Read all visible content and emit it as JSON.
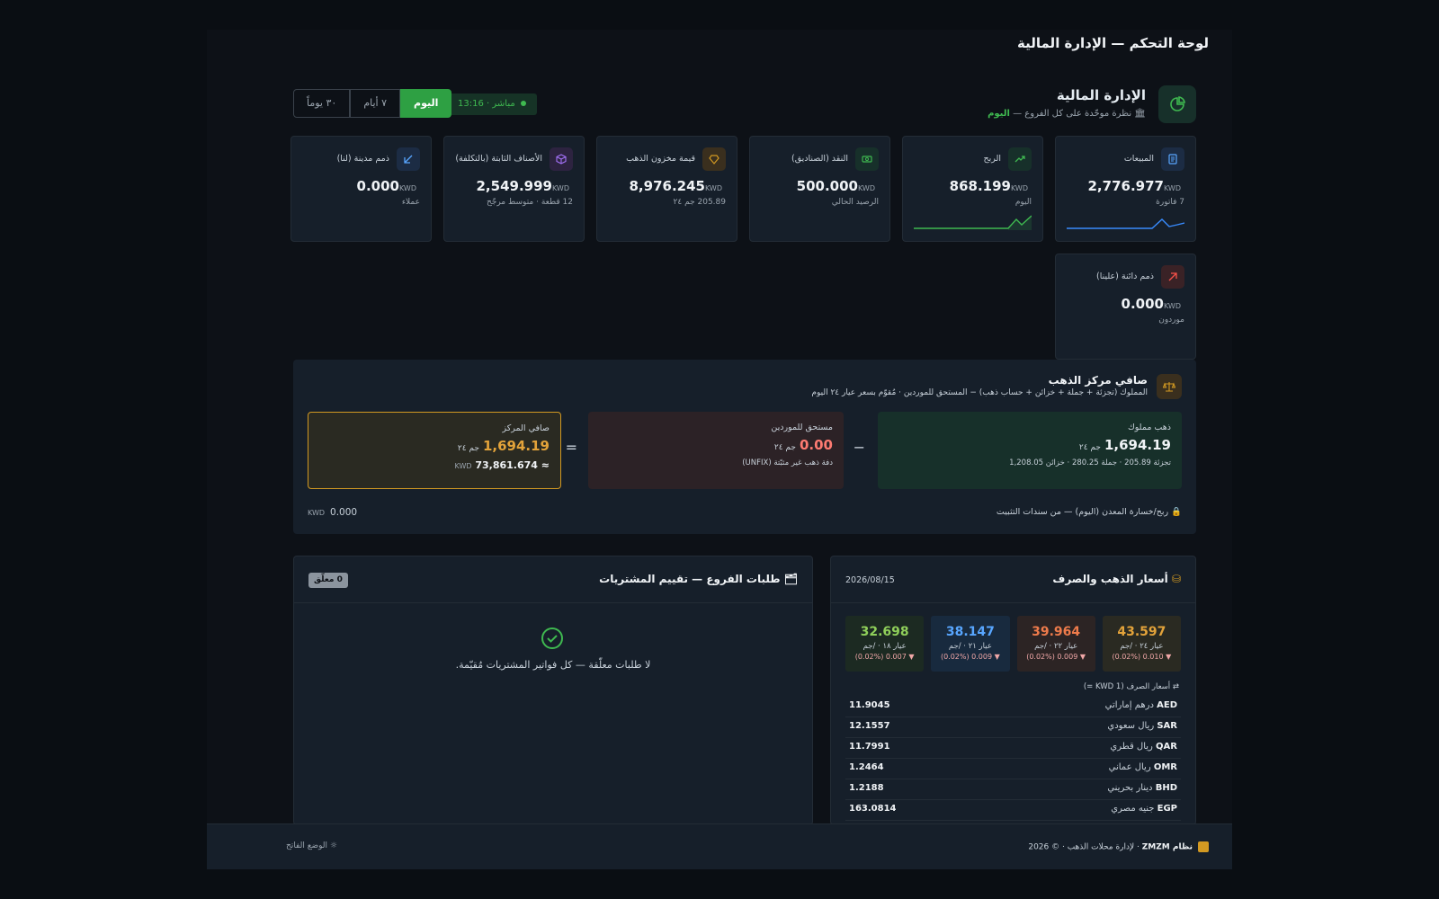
{
  "page_title": "لوحة التحكم — الإدارة المالية",
  "header": {
    "title": "الإدارة المالية",
    "subtitle_prefix": "نظرة موحّدة على كل الفروع —",
    "subtitle_highlight": "اليوم",
    "live_label": "مباشر",
    "live_time": "13:16",
    "ranges": [
      "اليوم",
      "٧ أيام",
      "٣٠ يوماً"
    ]
  },
  "cards": [
    {
      "label": "المبيعات",
      "value": "2,776.977",
      "currency": "KWD",
      "sub": "7 فاتورة",
      "icon": "receipt-icon",
      "color": "#388bfd"
    },
    {
      "label": "الربح",
      "value": "868.199",
      "currency": "KWD",
      "sub": "اليوم",
      "icon": "trending-up-icon",
      "color": "#3fb950"
    },
    {
      "label": "النقد (الصناديق)",
      "value": "500.000",
      "currency": "KWD",
      "sub": "الرصيد الحالي",
      "icon": "cash-icon",
      "color": "#3fb950"
    },
    {
      "label": "قيمة مخزون الذهب",
      "value": "8,976.245",
      "currency": "KWD",
      "sub": "205.89 جم ٢٤",
      "icon": "gem-icon",
      "color": "#d29922"
    },
    {
      "label": "الأصناف الثابتة (بالتكلفة)",
      "value": "2,549.999",
      "currency": "KWD",
      "sub": "12 قطعة · متوسط مرجّح",
      "icon": "box-icon",
      "color": "#a371f7"
    },
    {
      "label": "ذمم مدينة (لنا)",
      "value": "0.000",
      "currency": "KWD",
      "sub": "عملاء",
      "icon": "arrow-down-left-icon",
      "color": "#388bfd"
    },
    {
      "label": "ذمم دائنة (علينا)",
      "value": "0.000",
      "currency": "KWD",
      "sub": "موردون",
      "icon": "arrow-up-right-icon",
      "color": "#f85149"
    }
  ],
  "net_position": {
    "title": "صافي مركز الذهب",
    "description": "المملوك (تجزئة + جملة + خزائن + حساب ذهب) − المستحق للموردين · مُقوّم بسعر عيار ٢٤ اليوم",
    "owned": {
      "label": "ذهب مملوك",
      "value": "1,694.19",
      "unit": "جم ٢٤",
      "sub": "تجزئة 205.89 · جملة 280.25 · خزائن 1,208.05"
    },
    "minus": "−",
    "owed": {
      "label": "مستحق للموردين",
      "value": "0.00",
      "unit": "جم ٢٤",
      "sub": "دفة ذهب غير مثبّتة (UNFIX)"
    },
    "equals": "=",
    "net": {
      "label": "صافي المركز",
      "value": "1,694.19",
      "unit": "جم ٢٤",
      "kwd": "≈ 73,861.674",
      "currency": "KWD"
    },
    "footer_label": "ربح/خسارة المعدن (اليوم) — من سندات التثبيت",
    "footer_value": "0.000",
    "footer_currency": "KWD"
  },
  "requests": {
    "title": "طلبات الفروع — تقييم المشتريات",
    "badge": "0 معلّق",
    "empty": "لا طلبات معلّقة — كل فواتير المشتريات مُقيّمة."
  },
  "prices": {
    "title": "أسعار الذهب والصرف",
    "date": "2026/08/15",
    "gold": [
      {
        "value": "43.597",
        "label": "عيار ٢٤ · /جم",
        "change": "▼ 0.010 (0.02%)",
        "color": "#e3a33a",
        "bg": "#2a2a22"
      },
      {
        "value": "39.964",
        "label": "عيار ٢٢ · /جم",
        "change": "▼ 0.009 (0.02%)",
        "color": "#ee7b4b",
        "bg": "#2c2424"
      },
      {
        "value": "38.147",
        "label": "عيار ٢١ · /جم",
        "change": "▼ 0.009 (0.02%)",
        "color": "#58a6ff",
        "bg": "#182a3e"
      },
      {
        "value": "32.698",
        "label": "عيار ١٨ · /جم",
        "change": "▼ 0.007 (0.02%)",
        "color": "#8fcf5a",
        "bg": "#1c2a22"
      }
    ],
    "fx_header": "أسعار الصرف (1 KWD =)",
    "fx": [
      {
        "code": "AED",
        "name": "درهم إماراتي",
        "rate": "11.9045"
      },
      {
        "code": "SAR",
        "name": "ريال سعودي",
        "rate": "12.1557"
      },
      {
        "code": "QAR",
        "name": "ريال قطري",
        "rate": "11.7991"
      },
      {
        "code": "OMR",
        "name": "ريال عماني",
        "rate": "1.2464"
      },
      {
        "code": "BHD",
        "name": "دينار بحريني",
        "rate": "1.2188"
      },
      {
        "code": "EGP",
        "name": "جنيه مصري",
        "rate": "163.0814"
      }
    ]
  },
  "footer": {
    "brand": "نظام ZMZM",
    "tagline": "· لإدارة محلات الذهب · © 2026",
    "theme": "الوضع الفاتح"
  }
}
